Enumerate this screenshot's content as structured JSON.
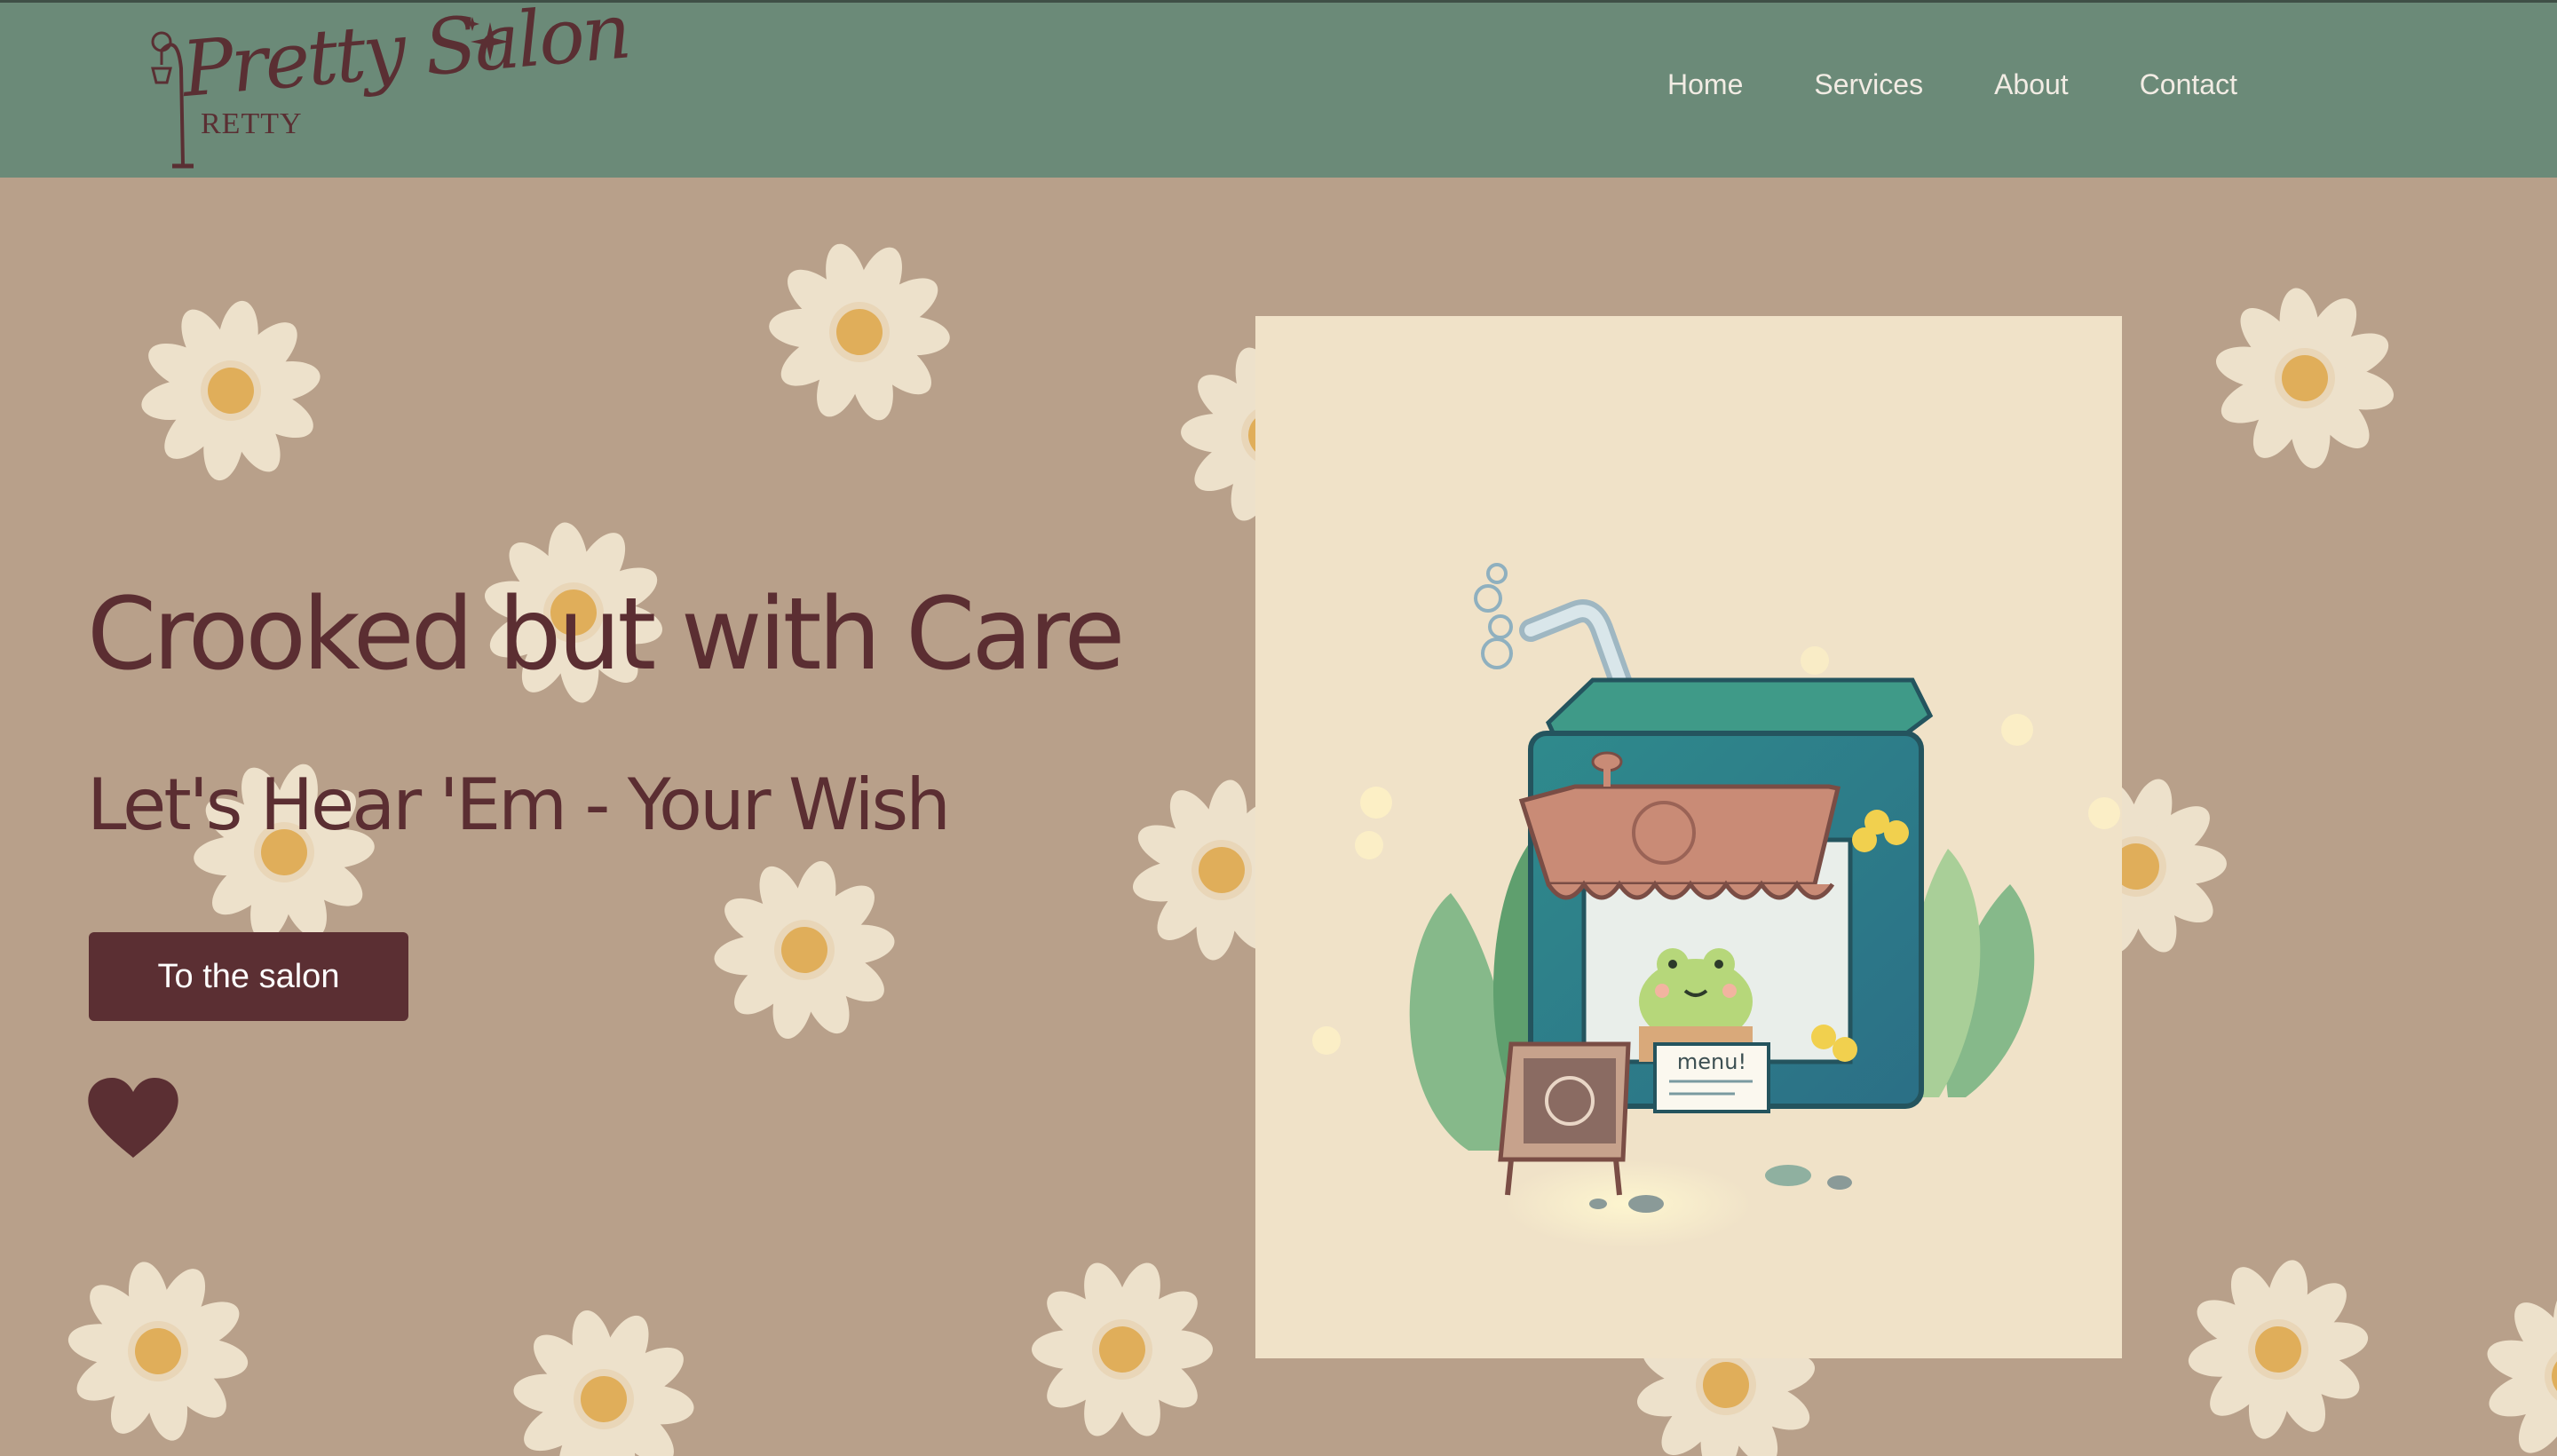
{
  "brand": {
    "wordmark": "Pretty Salon",
    "small_caps": "RETTY"
  },
  "nav": {
    "items": [
      {
        "label": "Home"
      },
      {
        "label": "Services"
      },
      {
        "label": "About"
      },
      {
        "label": "Contact"
      }
    ]
  },
  "hero": {
    "headline": "Crooked but with Care",
    "subheadline": "Let's Hear 'Em - Your Wish",
    "cta_label": "To the salon",
    "favorite_icon": "heart-icon"
  },
  "artwork": {
    "menu_sign": "menu!",
    "subject": "frog-kiosk-illustration"
  },
  "colors": {
    "header": "#6b8a78",
    "background": "#b8a08a",
    "accent": "#5b2f33",
    "nav_text": "#f2ece4",
    "daisy_petal": "#ede1cb",
    "daisy_center": "#e0ae5a"
  }
}
